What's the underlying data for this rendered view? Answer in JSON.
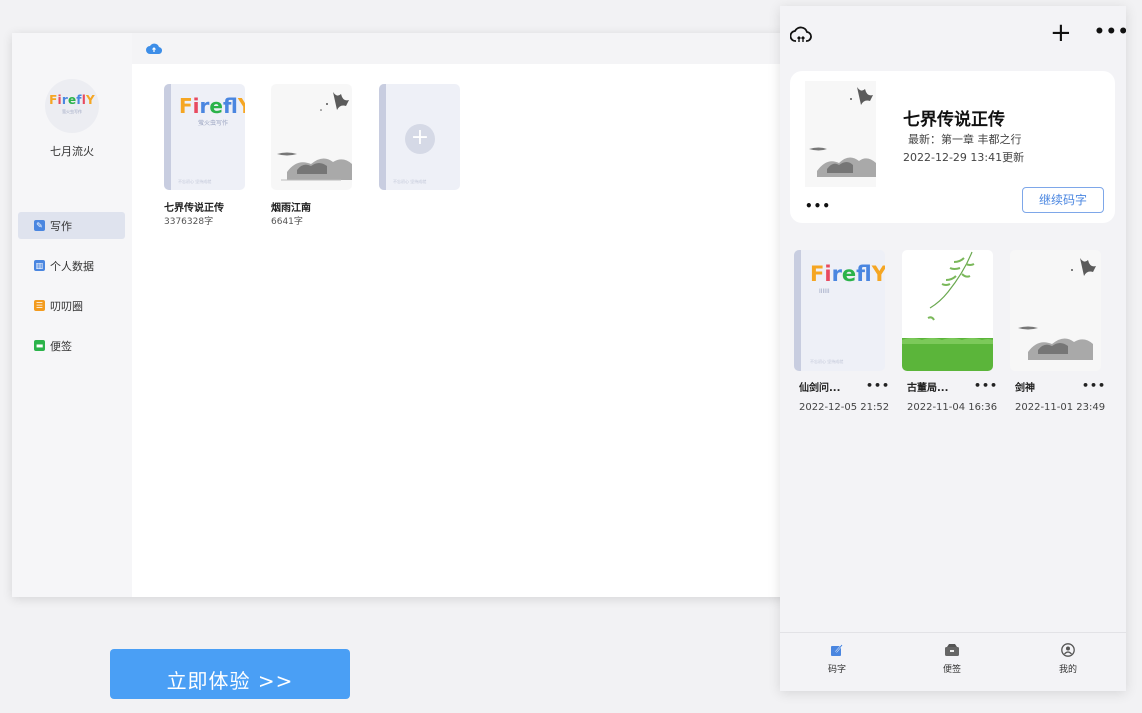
{
  "desktop": {
    "avatar_brand": "FireflY",
    "avatar_sub": "萤火虫写作",
    "username": "七月流火",
    "nav": [
      {
        "label": "写作",
        "icon": "pencil-icon",
        "color": "#4a86e0",
        "active": true
      },
      {
        "label": "个人数据",
        "icon": "chart-icon",
        "color": "#4a86e0",
        "active": false
      },
      {
        "label": "叨叨圈",
        "icon": "chat-icon",
        "color": "#f39b1e",
        "active": false
      },
      {
        "label": "便签",
        "icon": "note-icon",
        "color": "#2bb34a",
        "active": false
      }
    ],
    "books": [
      {
        "title": "七界传说正传",
        "count": "3376328字",
        "cover": "firefly",
        "cover_brand": "Firefly",
        "cover_sub": "萤火虫写作",
        "cover_foot": "不忘初心 坚持成就"
      },
      {
        "title": "烟雨江南",
        "count": "6641字",
        "cover": "ink-landscape"
      }
    ],
    "new_book_foot": "不忘初心 坚持成就"
  },
  "mobile": {
    "current": {
      "title": "七界传说正传",
      "latest": "最新：第一章 丰都之行",
      "updated": "2022-12-29 13:41更新",
      "more": "•••",
      "continue_label": "继续码字"
    },
    "books": [
      {
        "title": "仙剑问...",
        "date": "2022-12-05 21:52",
        "more": "•••",
        "cover": "firefly",
        "cover_brand": "Firefly",
        "cover_sub": "IIIIII",
        "cover_foot": "不忘初心 坚持成就"
      },
      {
        "title": "古董局...",
        "date": "2022-11-04 16:36",
        "more": "•••",
        "cover": "willow"
      },
      {
        "title": "剑神",
        "date": "2022-11-01 23:49",
        "more": "•••",
        "cover": "ink-landscape"
      }
    ],
    "tabs": [
      {
        "label": "码字",
        "icon": "write-icon",
        "active": true
      },
      {
        "label": "便签",
        "icon": "note-icon",
        "active": false
      },
      {
        "label": "我的",
        "icon": "profile-icon",
        "active": false
      }
    ],
    "header_more": "•••",
    "header_plus": "+"
  },
  "cta_label": "立即体验 >>",
  "colors": {
    "accent": "#4a86e0",
    "cta": "#4a9ff5",
    "firefly_f": "#f5a623"
  }
}
